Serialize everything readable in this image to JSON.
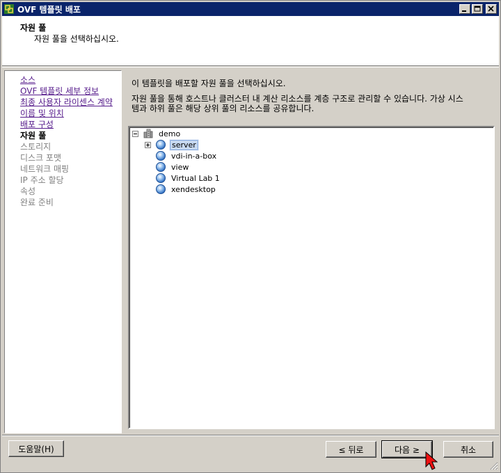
{
  "window": {
    "title": "OVF 템플릿 배포",
    "controls": {
      "minimize_icon": "minimize-icon",
      "maximize_icon": "maximize-icon",
      "close_icon": "close-icon"
    }
  },
  "header": {
    "title": "자원 풀",
    "subtitle": "자원 풀을 선택하십시오."
  },
  "nav": {
    "items": [
      {
        "label": "소스",
        "state": "link"
      },
      {
        "label": "OVF 템플릿 세부 정보",
        "state": "link"
      },
      {
        "label": "최종 사용자 라이센스 계약",
        "state": "link"
      },
      {
        "label": "이름 및 위치",
        "state": "link"
      },
      {
        "label": "배포 구성",
        "state": "link"
      },
      {
        "label": "자원 풀",
        "state": "current"
      },
      {
        "label": "스토리지",
        "state": "disabled"
      },
      {
        "label": "디스크 포맷",
        "state": "disabled"
      },
      {
        "label": "네트워크 매핑",
        "state": "disabled"
      },
      {
        "label": "IP 주소 할당",
        "state": "disabled"
      },
      {
        "label": "속성",
        "state": "disabled"
      },
      {
        "label": "완료 준비",
        "state": "disabled"
      }
    ]
  },
  "content": {
    "intro": "이 템플릿을 배포할 자원 풀을 선택하십시오.",
    "description_line1": "자원 풀을 통해 호스트나 클러스터 내 계산 리소스를 계층 구조로 관리할 수 있습니다. 가상 시스",
    "description_line2": "템과 하위 풀은 해당 상위 풀의 리소스를 공유합니다."
  },
  "tree": {
    "root": {
      "label": "demo",
      "icon": "datacenter-icon",
      "expanded": true
    },
    "children": [
      {
        "label": "server",
        "icon": "resource-pool-icon",
        "selected": true,
        "has_children": true
      },
      {
        "label": "vdi-in-a-box",
        "icon": "resource-pool-icon"
      },
      {
        "label": "view",
        "icon": "resource-pool-icon"
      },
      {
        "label": "Virtual Lab 1",
        "icon": "resource-pool-icon"
      },
      {
        "label": "xendesktop",
        "icon": "resource-pool-icon"
      }
    ]
  },
  "buttons": {
    "help": "도움말(H)",
    "back": "≤ 뒤로",
    "next": "다음 ≥",
    "cancel": "취소"
  },
  "colors": {
    "titlebar": "#0a246a",
    "face": "#d4d0c8",
    "link": "#551a8b",
    "selection": "#c7d9f1"
  }
}
